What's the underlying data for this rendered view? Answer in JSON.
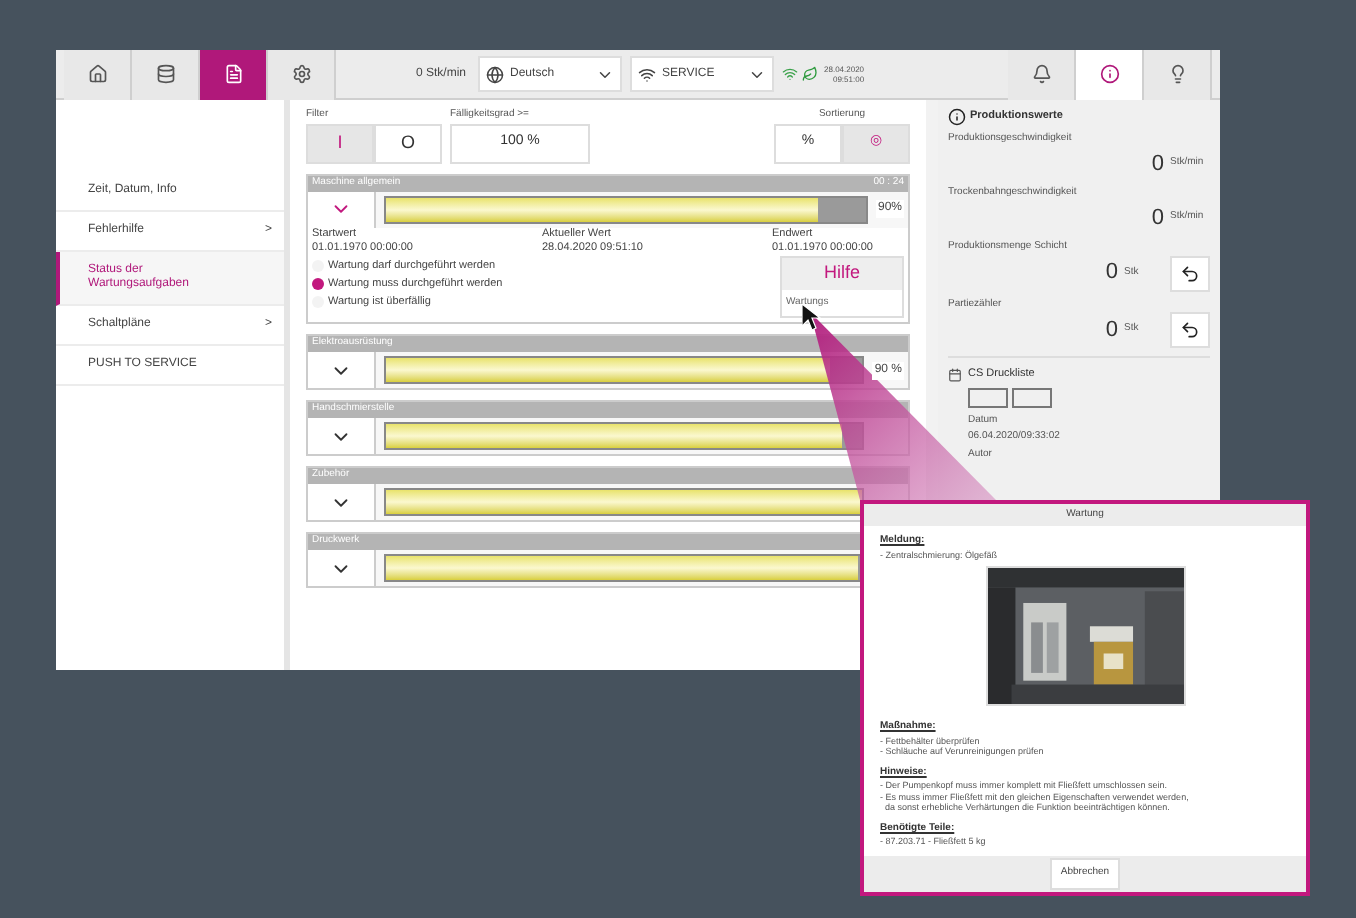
{
  "topbar": {
    "tabs_left": [
      {
        "selected": false
      },
      {
        "selected": false
      },
      {
        "selected": true
      },
      {
        "selected": false
      }
    ],
    "speed": "0 Stk/min",
    "language": "Deutsch",
    "mode": "SERVICE",
    "date": "28.04.2020",
    "time": "09:51:00",
    "tabs_right": [
      {
        "selected": false
      },
      {
        "selected": true
      },
      {
        "selected": false
      }
    ]
  },
  "sidebar": {
    "items": [
      {
        "label": "Zeit, Datum, Info",
        "selected": false
      },
      {
        "label": "Fehlerhilfe",
        "arrow": ">",
        "selected": false
      },
      {
        "label": "Status der Wartungsaufgaben",
        "selected": true
      },
      {
        "label": "Schaltpläne",
        "arrow": ">",
        "selected": false
      },
      {
        "label": "PUSH TO SERVICE",
        "selected": false
      }
    ]
  },
  "filter": {
    "label": "Filter",
    "buttons": [
      {
        "label": "I",
        "selected": true
      },
      {
        "label": "O",
        "selected": false
      }
    ],
    "degree_label": "Fälligkeitsgrad >=",
    "degree_value": "100 %"
  },
  "sorting": {
    "label": "Sortierung",
    "buttons": [
      {
        "label": "%",
        "selected": false
      },
      {
        "label": "◎",
        "selected": true
      }
    ]
  },
  "tasks": [
    {
      "title": "Maschine allgemein",
      "counter": "00 : 24",
      "level": 0.9,
      "reading": "90%",
      "expanded": true,
      "start_label": "Startwert",
      "start_value": "01.01.1970 00:00:00",
      "current_label": "Aktueller Wert",
      "current_value": "28.04.2020 09:51:10",
      "end_label": "Endwert",
      "end_value": "01.01.1970 00:00:00",
      "legend": [
        {
          "label": "Wartung darf durchgeführt werden",
          "color": "#f3f3f3"
        },
        {
          "label": "Wartung muss durchgeführt werden",
          "color": "#c2187e"
        },
        {
          "label": "Wartung ist überfällig",
          "color": "#f3f3f3"
        }
      ],
      "help": "Hilfe",
      "help_note": "Wartungs"
    },
    {
      "title": "Elektroausrüstung",
      "level": 0.93,
      "reading": "90 %",
      "expanded": false
    },
    {
      "title": "Handschmierstelle",
      "level": 0.96,
      "expanded": false
    },
    {
      "title": "Zubehör",
      "level": 1,
      "expanded": false
    },
    {
      "title": "Druckwerk",
      "level": 0.99,
      "expanded": false
    }
  ],
  "production": {
    "title": "Produktionswerte",
    "values": [
      {
        "label": "Produktionsgeschwindigkeit",
        "value": "0",
        "unit": "Stk/min",
        "reset": false
      },
      {
        "label": "Trockenbahngeschwindigkeit",
        "value": "0",
        "unit": "Stk/min",
        "reset": false
      },
      {
        "label": "Produktionsmenge Schicht",
        "value": "0",
        "unit": "Stk",
        "reset": true
      },
      {
        "label": "Partiezähler",
        "value": "0",
        "unit": "Stk",
        "reset": true
      }
    ]
  },
  "print_list": {
    "title": "CS Druckliste",
    "date_label": "Datum",
    "date_value": "06.04.2020/09:33:02",
    "author_label": "Autor"
  },
  "dialog": {
    "title": "Wartung",
    "sections": [
      {
        "heading": "Meldung:",
        "lines": [
          "- Zentralschmierung: Ölgefäß"
        ],
        "picture": true
      },
      {
        "heading": "Maßnahme:",
        "lines": [
          "- Fettbehälter überprüfen",
          "- Schläuche auf Verunreinigungen prüfen"
        ],
        "picture": false
      },
      {
        "heading": "Hinweise:",
        "lines": [
          "- Der Pumpenkopf muss immer komplett mit Fließfett umschlossen sein.",
          "- Es muss immer Fließfett mit den gleichen Eigenschaften verwendet werden,",
          "  da sonst erhebliche Verhärtungen die Funktion beeinträchtigen können."
        ],
        "picture": false
      },
      {
        "heading": "Benötigte Teile:",
        "lines": [
          "- 87.203.71 - Fließfett 5 kg"
        ],
        "picture": false
      }
    ],
    "button": "Abbrechen"
  }
}
